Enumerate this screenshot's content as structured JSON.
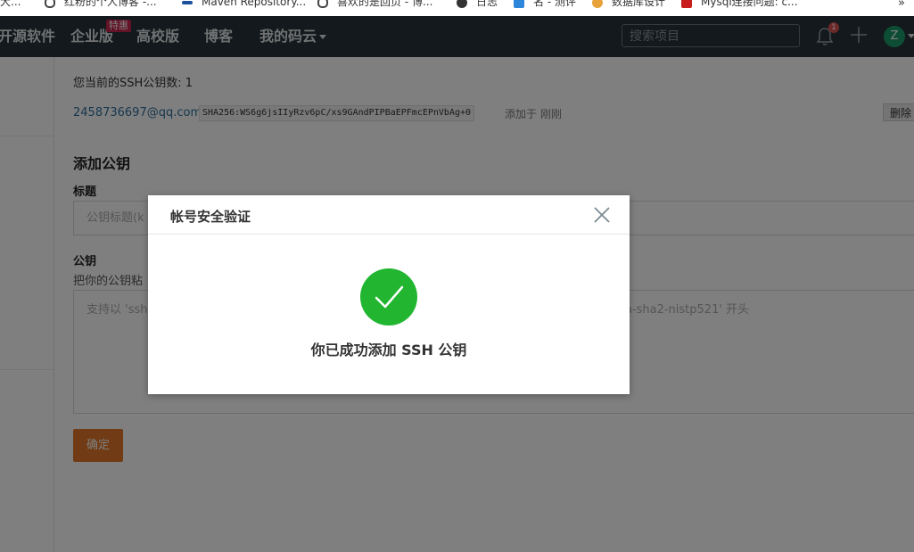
{
  "bookmarks": {
    "items": [
      {
        "label": "大...",
        "color": "#ffffff"
      },
      {
        "label": "红粉的个人博客 -...",
        "color": "#e6b200"
      },
      {
        "label": "Maven Repository...",
        "color": "#1a4f9c"
      },
      {
        "label": "喜欢的是回页 - 博...",
        "color": "#e6b200"
      },
      {
        "label": "日志",
        "color": "#333333"
      },
      {
        "label": "名 - 测评",
        "color": "#2d86d9"
      },
      {
        "label": "数据库设计",
        "color": "#e8a23a"
      },
      {
        "label": "Mysql连接问题: c...",
        "color": "#c81c1c"
      }
    ],
    "more": "»"
  },
  "nav": {
    "items": [
      "开源软件",
      "企业版",
      "高校版",
      "博客",
      "我的码云"
    ],
    "special_badge": "特惠",
    "search_placeholder": "搜索项目",
    "notification_count": "1",
    "avatar_letter": "Z"
  },
  "ssh": {
    "count_text": "您当前的SSH公钥数: 1",
    "key_email": "2458736697@qq.com",
    "key_fingerprint": "SHA256:WS6g6jsIIyRzv6pC/xs9GAndPIPBaEPFmcEPnVbAg+0",
    "key_added": "添加于 刚刚",
    "delete_label": "删除"
  },
  "form": {
    "section_title": "添加公钥",
    "title_label": "标题",
    "title_placeholder": "公钥标题(k",
    "key_label": "公钥",
    "key_help": "把你的公钥粘",
    "key_placeholder": "支持以 'ssh-rsa', 'ssh-dss', 'ssh-ed25519', 'ecdsa-sha2-nistp256', 'ecdsa-sha2-nistp384', 'ecdsa-sha2-nistp521' 开头",
    "confirm_label": "确定"
  },
  "modal": {
    "title": "帐号安全验证",
    "message": "你已成功添加 SSH 公钥",
    "icon": "success-check-icon",
    "success_color": "#21b530"
  }
}
